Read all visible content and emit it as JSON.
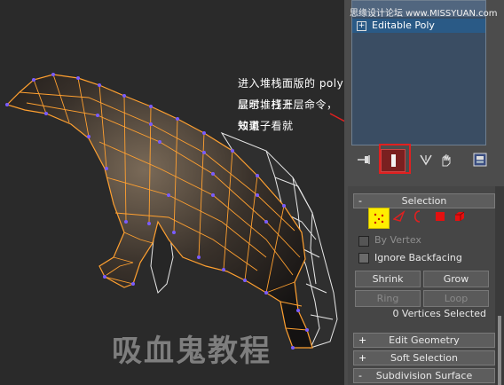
{
  "annotation": {
    "lines": [
      "进入堆栈面版的 poly 层时，打开",
      "显示堆栈上层命令，效果一看就",
      "知道了"
    ]
  },
  "watermark": "吸血鬼教程",
  "site_mark": "思缘设计论坛 www.MISSYUAN.com",
  "stack": {
    "item_label": "Editable Poly",
    "expand_glyph": "+"
  },
  "toolbar": {
    "icons": [
      "pin-stack-icon",
      "show-end-result-icon",
      "make-unique-icon",
      "remove-modifier-icon",
      "configure-modifier-sets-icon"
    ]
  },
  "selection": {
    "header": "Selection",
    "collapse_sign": "-",
    "by_vertex": "By Vertex",
    "ignore_backfacing": "Ignore Backfacing",
    "shrink": "Shrink",
    "grow": "Grow",
    "ring": "Ring",
    "loop": "Loop",
    "status": "0 Vertices Selected",
    "subobject_icons": [
      "vertex-icon",
      "edge-icon",
      "border-icon",
      "polygon-icon",
      "element-icon"
    ]
  },
  "rollouts": [
    {
      "sign": "+",
      "label": "Edit Geometry"
    },
    {
      "sign": "+",
      "label": "Soft Selection"
    },
    {
      "sign": "-",
      "label": "Subdivision Surface"
    }
  ],
  "colors": {
    "viewport_bg": "#2a2a2a",
    "mesh_wire": "#ffa030",
    "vertex": "#7a5cff",
    "highlight_box": "#e02020",
    "stack_selected": "#2a5a86"
  }
}
